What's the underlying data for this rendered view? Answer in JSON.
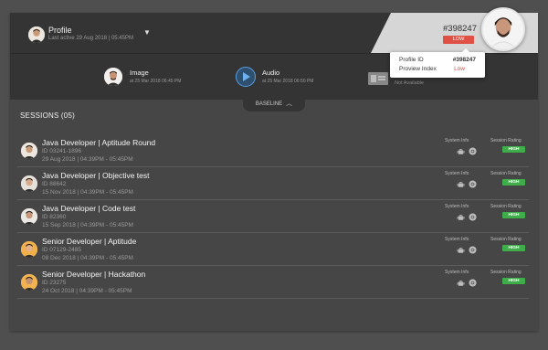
{
  "header": {
    "profile_name": "Profile",
    "profile_sub": "Last active 29 Aug 2018 | 05:45PM",
    "profile_id": "#398247",
    "risk_badge": "LOW"
  },
  "popover": {
    "rows": [
      {
        "label": "Profile ID",
        "value": "#398247"
      },
      {
        "label": "Proview Index",
        "value": "Low"
      }
    ]
  },
  "media": {
    "image_label": "Image",
    "image_time": "at 25 Mar 2018 06:45 PM",
    "audio_label": "Audio",
    "audio_time": "at 25 Mar 2018 06:50 PM",
    "document_status": "Not Available"
  },
  "baseline_label": "BASELINE",
  "sessions_title": "SESSIONS (05)",
  "column_labels": {
    "system": "System Info",
    "rating": "Session Rating"
  },
  "sessions": [
    {
      "title": "Java Developer |  Aptitude Round",
      "id": "ID  03241-1896",
      "date": "29 Aug 2018  | 04:39PM - 05:45PM",
      "rating": "HIGH"
    },
    {
      "title": "Java Developer | Objective test",
      "id": "ID  88642",
      "date": "15 Nov 2018  | 04:39PM - 05:45PM",
      "rating": "HIGH"
    },
    {
      "title": "Java Developer | Code test",
      "id": "ID  82360",
      "date": "15 Sep 2018  | 04:39PM - 05:45PM",
      "rating": "HIGH"
    },
    {
      "title": "Senior Developer | Aptitude",
      "id": "ID  07129-2485",
      "date": "08 Dec 2018  | 04:39PM - 05:45PM",
      "rating": "HIGH"
    },
    {
      "title": "Senior Developer | Hackathon",
      "id": "ID  23275",
      "date": "24 Oct 2018  | 04:39PM - 05:45PM",
      "rating": "HIGH"
    }
  ],
  "icons": {
    "os": "android-icon",
    "browser": "chrome-icon",
    "play": "play-icon",
    "document": "id-card-icon"
  },
  "colors": {
    "low": "#e05045",
    "high": "#3fae4a",
    "accent": "#5aa0e0"
  }
}
